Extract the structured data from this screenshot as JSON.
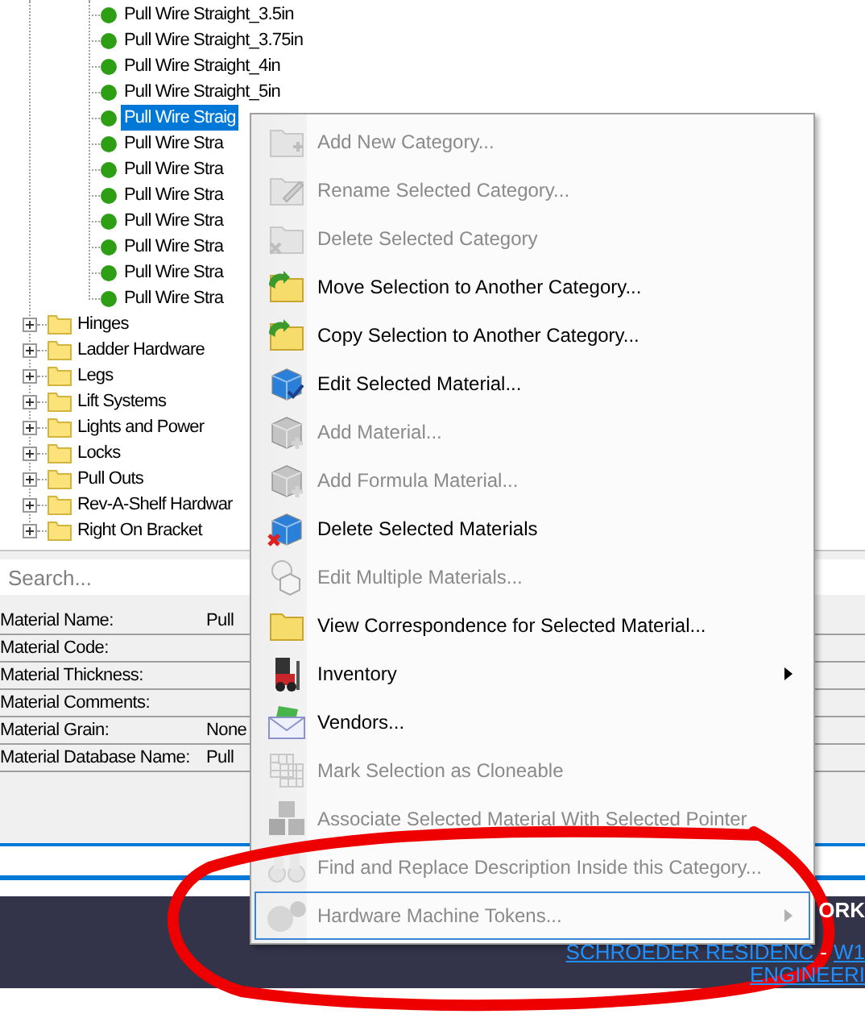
{
  "tree": {
    "materials": [
      {
        "label": "Pull Wire Straight_3.5in",
        "selected": false
      },
      {
        "label": "Pull Wire Straight_3.75in",
        "selected": false
      },
      {
        "label": "Pull Wire Straight_4in",
        "selected": false
      },
      {
        "label": "Pull Wire Straight_5in",
        "selected": false
      },
      {
        "label": "Pull Wire Straig",
        "selected": true
      },
      {
        "label": "Pull Wire Stra",
        "selected": false
      },
      {
        "label": "Pull Wire Stra",
        "selected": false
      },
      {
        "label": "Pull Wire Stra",
        "selected": false
      },
      {
        "label": "Pull Wire Stra",
        "selected": false
      },
      {
        "label": "Pull Wire Stra",
        "selected": false
      },
      {
        "label": "Pull Wire Stra",
        "selected": false
      },
      {
        "label": "Pull Wire Stra",
        "selected": false
      }
    ],
    "categories": [
      {
        "label": "Hinges",
        "expanded": false
      },
      {
        "label": "Ladder Hardware",
        "expanded": false
      },
      {
        "label": "Legs",
        "expanded": false
      },
      {
        "label": "Lift Systems",
        "expanded": false
      },
      {
        "label": "Lights and Power",
        "expanded": false
      },
      {
        "label": "Locks",
        "expanded": false
      },
      {
        "label": "Pull Outs",
        "expanded": false
      },
      {
        "label": "Rev-A-Shelf Hardwar",
        "expanded": false
      },
      {
        "label": "Right On Bracket",
        "expanded": false
      }
    ]
  },
  "search": {
    "placeholder": "Search..."
  },
  "properties": [
    {
      "label": "Material Name:",
      "value": "Pull"
    },
    {
      "label": "Material Code:"
    },
    {
      "label": "Material Thickness:"
    },
    {
      "label": "Material Comments:"
    },
    {
      "label": "Material Grain:",
      "value": "None"
    },
    {
      "label": "Material Database Name:",
      "value": "Pull"
    }
  ],
  "status": {
    "title": "ORK",
    "project": "SCHROEDER RESIDENC",
    "separator": "-",
    "link": "W1",
    "footer": "ENGINEERI"
  },
  "context_menu": [
    {
      "label": "Add New Category...",
      "disabled": true,
      "submenu": false,
      "selected": false
    },
    {
      "label": "Rename Selected Category...",
      "disabled": true,
      "submenu": false,
      "selected": false
    },
    {
      "label": "Delete Selected Category",
      "disabled": true,
      "submenu": false,
      "selected": false
    },
    {
      "label": "Move Selection to Another Category...",
      "disabled": false,
      "submenu": false,
      "selected": false
    },
    {
      "label": "Copy Selection to Another Category...",
      "disabled": false,
      "submenu": false,
      "selected": false
    },
    {
      "label": "Edit Selected Material...",
      "disabled": false,
      "submenu": false,
      "selected": false
    },
    {
      "label": "Add Material...",
      "disabled": true,
      "submenu": false,
      "selected": false
    },
    {
      "label": "Add Formula Material...",
      "disabled": true,
      "submenu": false,
      "selected": false
    },
    {
      "label": "Delete Selected Materials",
      "disabled": false,
      "submenu": false,
      "selected": false
    },
    {
      "label": "Edit Multiple Materials...",
      "disabled": true,
      "submenu": false,
      "selected": false
    },
    {
      "label": "View Correspondence for Selected Material...",
      "disabled": false,
      "submenu": false,
      "selected": false
    },
    {
      "label": "Inventory",
      "disabled": false,
      "submenu": true,
      "selected": false
    },
    {
      "label": "Vendors...",
      "disabled": false,
      "submenu": false,
      "selected": false
    },
    {
      "label": "Mark Selection as Cloneable",
      "disabled": true,
      "submenu": false,
      "selected": false
    },
    {
      "label": "Associate Selected Material With Selected Pointer",
      "disabled": true,
      "submenu": false,
      "selected": false
    },
    {
      "label": "Find and Replace Description Inside this Category...",
      "disabled": true,
      "submenu": false,
      "selected": false
    },
    {
      "label": "Hardware Machine Tokens...",
      "disabled": true,
      "submenu": true,
      "selected": true
    }
  ]
}
